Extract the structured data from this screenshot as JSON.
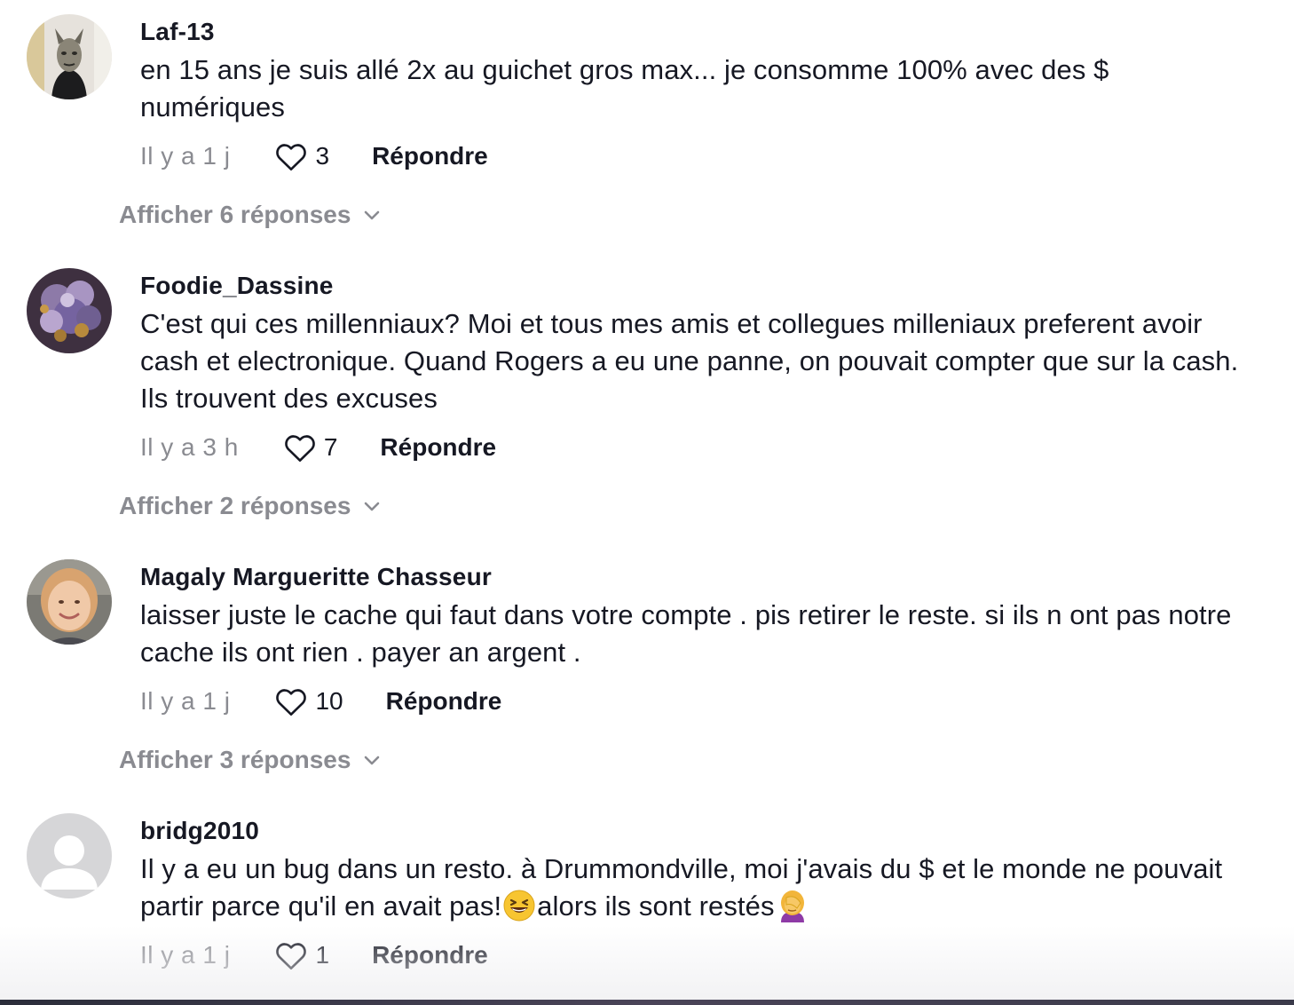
{
  "comments": [
    {
      "username": "Laf-13",
      "text": "en 15 ans je suis allé 2x au guichet gros max... je consomme 100% avec des $ numériques",
      "time": "Il y a 1 j",
      "likes": "3",
      "reply_label": "Répondre",
      "view_replies": "Afficher 6 réponses"
    },
    {
      "username": "Foodie_Dassine",
      "text": "C'est qui ces millenniaux? Moi et tous mes amis et collegues milleniaux preferent avoir cash et electronique. Quand Rogers a eu une panne, on pouvait compter que sur la cash. Ils trouvent des excuses",
      "time": "Il y a 3 h",
      "likes": "7",
      "reply_label": "Répondre",
      "view_replies": "Afficher 2 réponses"
    },
    {
      "username": "Magaly Margueritte Chasseur",
      "text": "laisser juste le cache qui faut dans votre compte . pis retirer le reste. si ils n ont pas notre cache ils ont rien . payer an argent .",
      "time": "Il y a 1 j",
      "likes": "10",
      "reply_label": "Répondre",
      "view_replies": "Afficher 3 réponses"
    },
    {
      "username": "bridg2010",
      "text_part1": "Il y a eu un bug dans un resto. à Drummondville, moi j'avais du $ et le monde ne pouvait partir parce qu'il en avait pas!",
      "text_part2": "alors ils sont restés",
      "time": "Il y a 1 j",
      "likes": "1",
      "reply_label": "Répondre"
    }
  ],
  "icons": {
    "like": "heart-outline-icon",
    "expand": "chevron-down-icon",
    "emoji1": "grinning-squinting-face-emoji",
    "emoji2": "woman-facepalming-emoji"
  },
  "colors": {
    "primary_text": "#161823",
    "secondary_text": "#8a8b91"
  }
}
